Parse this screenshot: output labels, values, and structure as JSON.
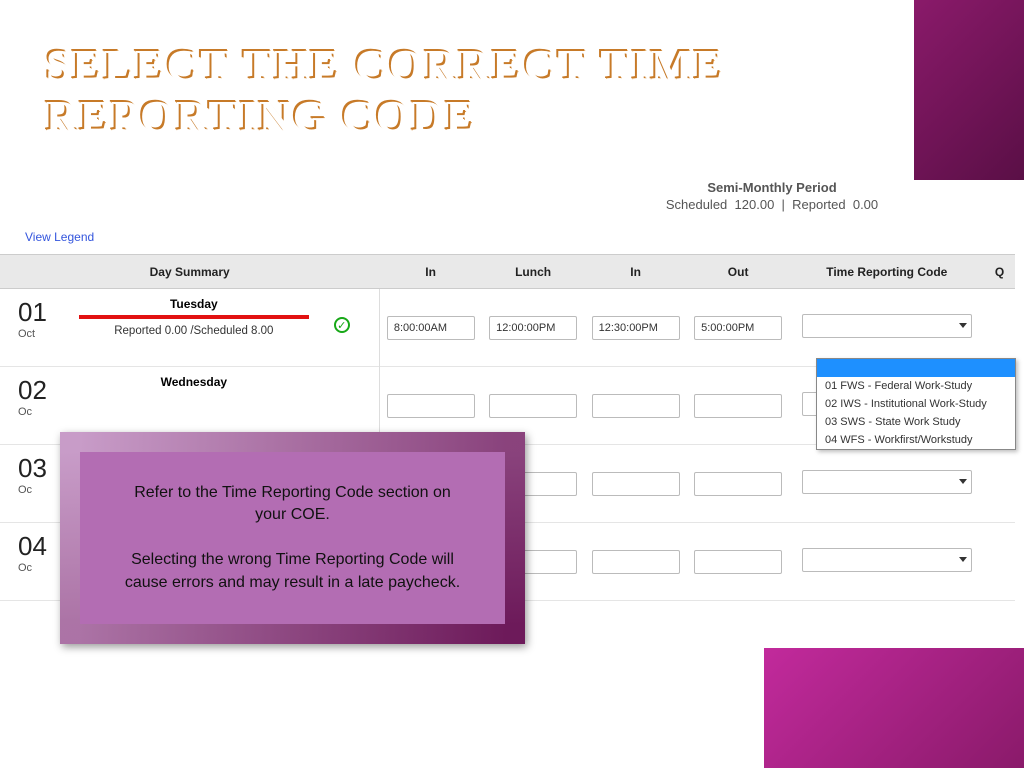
{
  "title_line1": "SELECT THE CORRECT TIME",
  "title_line2": "REPORTING CODE",
  "period": {
    "title": "Semi-Monthly Period",
    "scheduled_label": "Scheduled",
    "scheduled_value": "120.00",
    "reported_label": "Reported",
    "reported_value": "0.00"
  },
  "view_legend": "View Legend",
  "headers": {
    "day_summary": "Day Summary",
    "in1": "In",
    "lunch": "Lunch",
    "in2": "In",
    "out": "Out",
    "trc": "Time Reporting Code",
    "q": "Q"
  },
  "rows": [
    {
      "num": "01",
      "month": "Oct",
      "dayname": "Tuesday",
      "redbar": true,
      "reported": "Reported 0.00 /Scheduled 8.00",
      "ok": true,
      "in1": "8:00:00AM",
      "lunch": "12:00:00PM",
      "in2": "12:30:00PM",
      "out": "5:00:00PM",
      "trc_open": true
    },
    {
      "num": "02",
      "month": "Oc",
      "dayname": "Wednesday",
      "redbar": false
    },
    {
      "num": "03",
      "month": "Oc",
      "dayname": "",
      "redbar": false
    },
    {
      "num": "04",
      "month": "Oc",
      "dayname": "",
      "redbar": false
    }
  ],
  "dropdown": [
    "01 FWS - Federal Work-Study",
    "02 IWS - Institutional Work-Study",
    "03 SWS - State Work Study",
    "04 WFS - Workfirst/Workstudy"
  ],
  "callout": {
    "p1": "Refer to the Time Reporting Code section on your COE.",
    "p2": "Selecting the wrong Time Reporting Code will cause errors and may result in a late paycheck."
  }
}
